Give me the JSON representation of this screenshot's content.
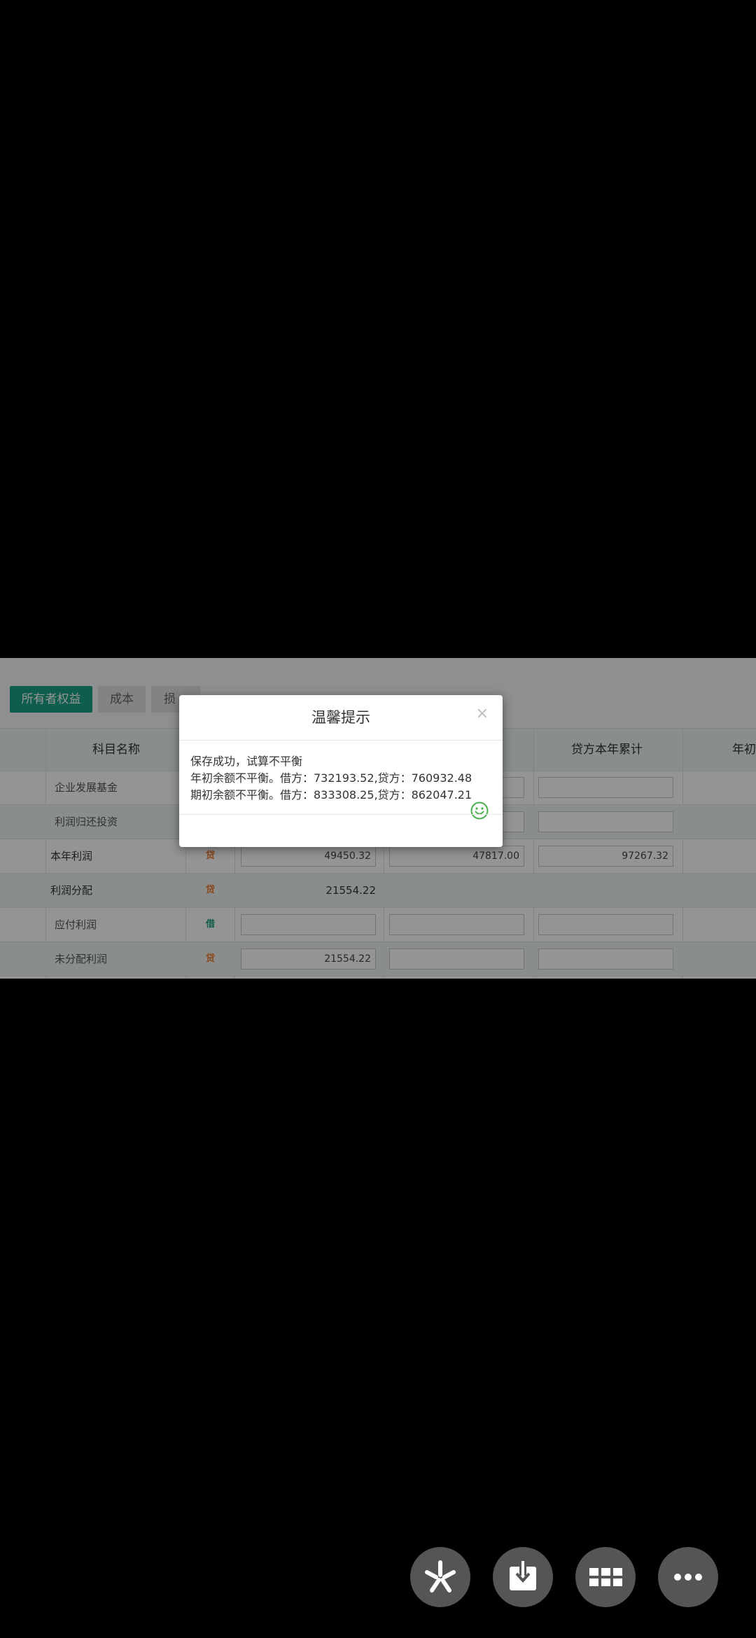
{
  "tabs": [
    "所有者权益",
    "成本",
    "损"
  ],
  "table": {
    "headers": {
      "name": "科目名称",
      "credit_ytd": "贷方本年累计",
      "year_begin": "年初"
    },
    "rows": [
      {
        "name": "企业发展基金",
        "level": "sub",
        "dir": "",
        "v1": "",
        "v2": "",
        "v3": ""
      },
      {
        "name": "利润归还投资",
        "level": "sub",
        "dir": "",
        "v1": "",
        "v2": "",
        "v3": ""
      },
      {
        "name": "本年利润",
        "level": "top",
        "dir": "贷",
        "v1": "49450.32",
        "v2": "47817.00",
        "v3": "97267.32"
      },
      {
        "name": "利润分配",
        "level": "top",
        "dir": "贷",
        "v1": "21554.22",
        "v2": "",
        "v3": ""
      },
      {
        "name": "应付利润",
        "level": "sub",
        "dir": "借",
        "v1": "",
        "v2": "",
        "v3": ""
      },
      {
        "name": "未分配利润",
        "level": "sub",
        "dir": "贷",
        "v1": "21554.22",
        "v2": "",
        "v3": ""
      }
    ]
  },
  "dialog": {
    "title": "温馨提示",
    "close": "×",
    "lines": [
      "保存成功，试算不平衡",
      "年初余额不平衡。借方：732193.52,贷方：760932.48",
      "期初余额不平衡。借方：833308.25,贷方：862047.21"
    ],
    "icon": "smile-icon"
  },
  "actions": [
    "sparkle-icon",
    "download-icon",
    "grid-icon",
    "more-icon"
  ]
}
